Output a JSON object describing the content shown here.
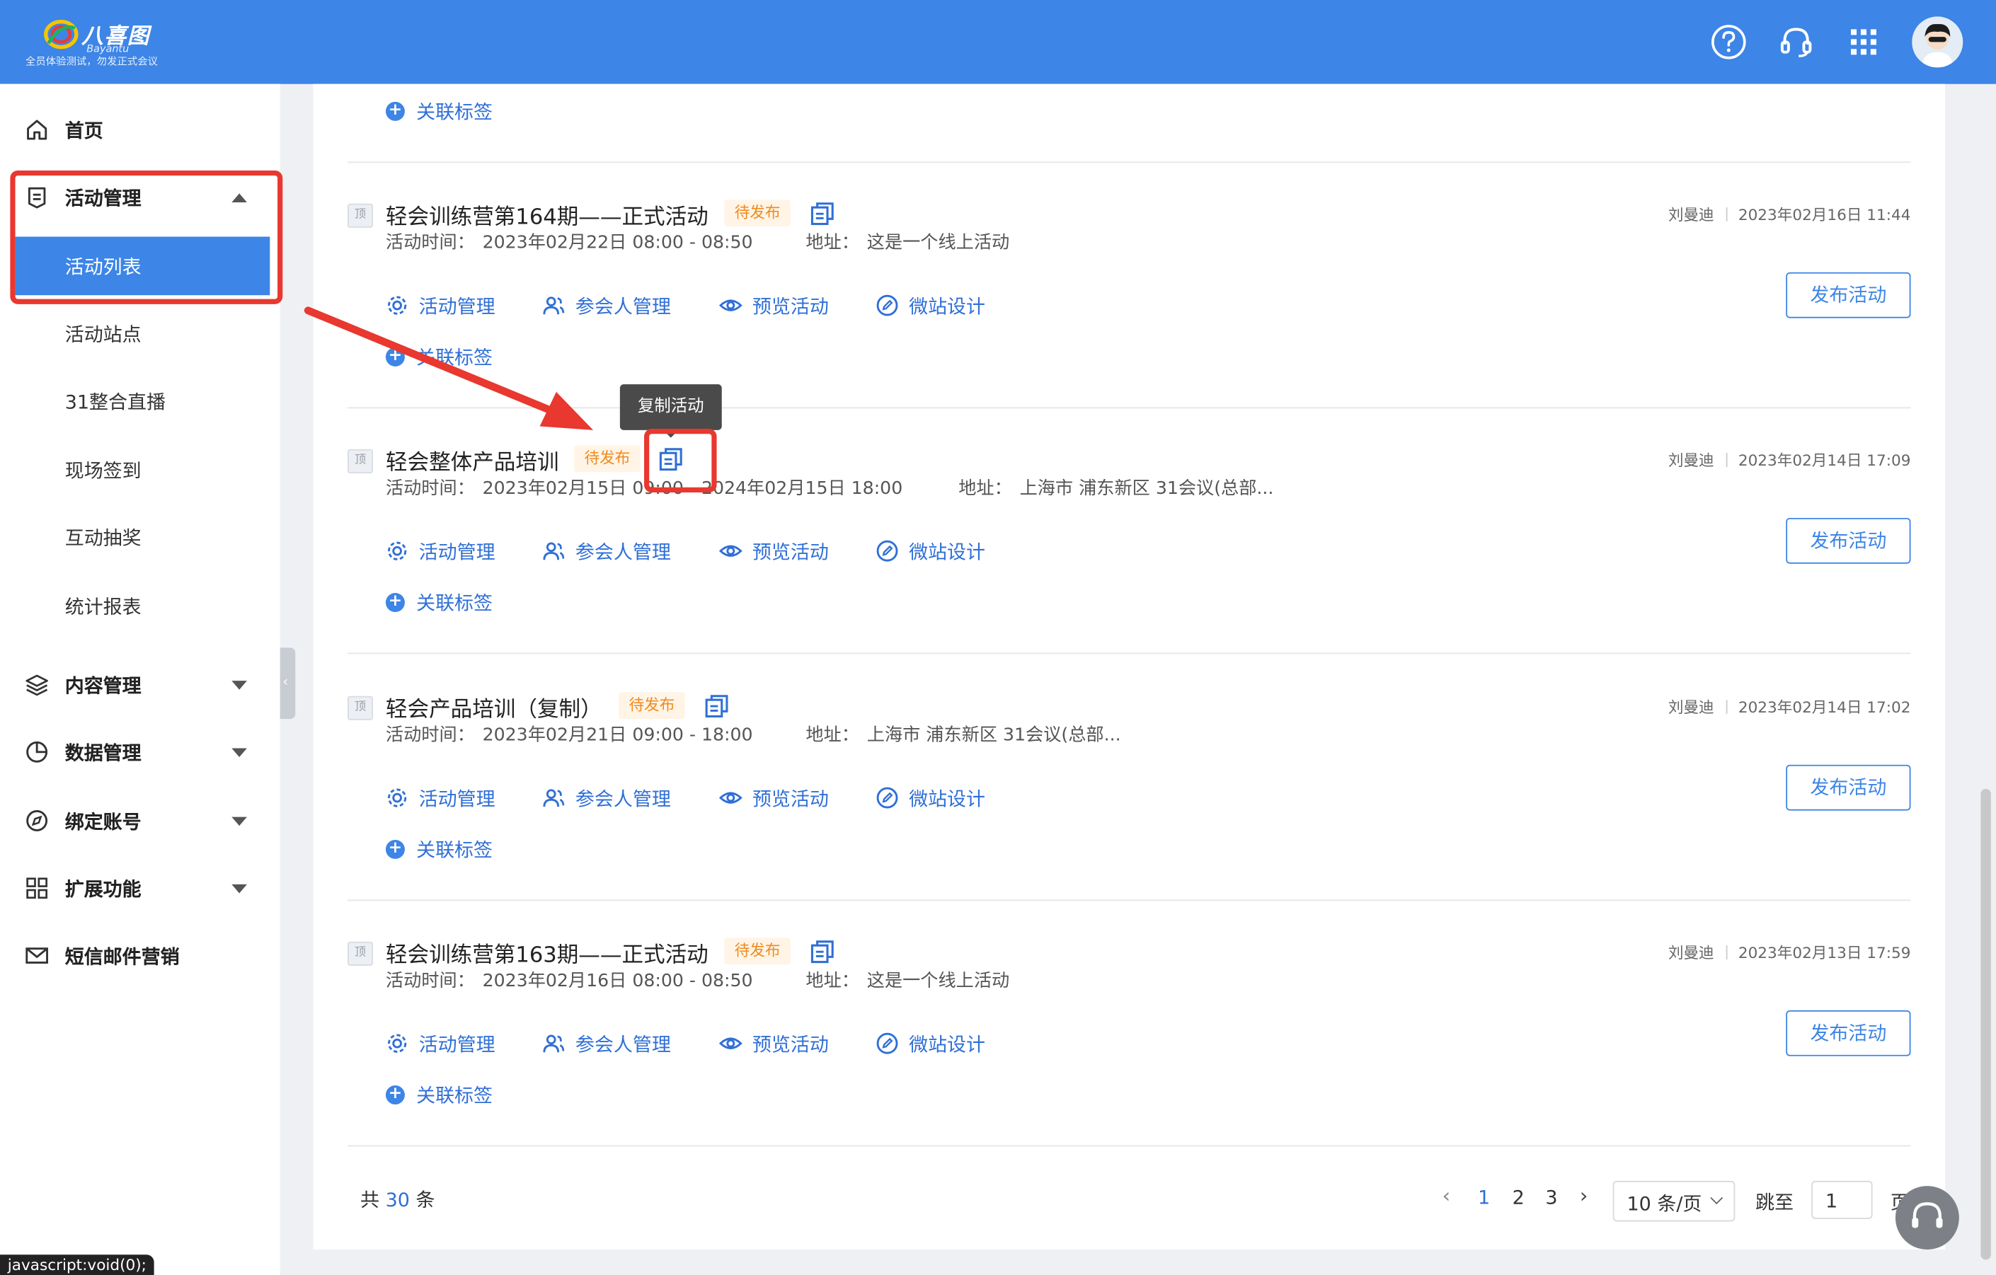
{
  "brand": {
    "name": "八喜图",
    "name_en": "Bayantu",
    "slogan": "全员体验测试，勿发正式会议"
  },
  "header": {
    "icons": [
      "help-circle-icon",
      "headset-icon",
      "apps-grid-icon"
    ],
    "accent": "#3d85e6"
  },
  "sidebar": {
    "home": "首页",
    "activity_mgmt": "活动管理",
    "sub_items": [
      "活动列表",
      "活动站点",
      "31整合直播",
      "现场签到",
      "互动抽奖",
      "统计报表"
    ],
    "content_mgmt": "内容管理",
    "data_mgmt": "数据管理",
    "bind_account": "绑定账号",
    "extensions": "扩展功能",
    "sms_email": "短信邮件营销"
  },
  "ops": {
    "manage": "活动管理",
    "attendees": "参会人管理",
    "preview": "预览活动",
    "microsite": "微站设计",
    "tag": "关联标签",
    "publish": "发布活动"
  },
  "labels": {
    "top_badge": "顶",
    "time_prefix": "活动时间：",
    "addr_prefix": "地址："
  },
  "tooltip": "复制活动",
  "activities": [
    {
      "title": "轻会训练营第164期——正式活动",
      "status": "待发布",
      "time": "2023年02月22日 08:00 - 08:50",
      "address": "这是一个线上活动",
      "author": "刘曼迪",
      "created": "2023年02月16日 11:44"
    },
    {
      "title": "轻会整体产品培训",
      "status": "待发布",
      "time": "2023年02月15日 09:00 - 2024年02月15日 18:00",
      "address": "上海市 浦东新区 31会议(总部...",
      "author": "刘曼迪",
      "created": "2023年02月14日 17:09"
    },
    {
      "title": "轻会产品培训（复制）",
      "status": "待发布",
      "time": "2023年02月21日 09:00 - 18:00",
      "address": "上海市 浦东新区 31会议(总部...",
      "author": "刘曼迪",
      "created": "2023年02月14日 17:02"
    },
    {
      "title": "轻会训练营第163期——正式活动",
      "status": "待发布",
      "time": "2023年02月16日 08:00 - 08:50",
      "address": "这是一个线上活动",
      "author": "刘曼迪",
      "created": "2023年02月13日 17:59"
    }
  ],
  "pagination": {
    "total_prefix": "共",
    "total": "30",
    "total_suffix": "条",
    "pages": [
      "1",
      "2",
      "3"
    ],
    "current": "1",
    "page_size": "10 条/页",
    "jump_label": "跳至",
    "jump_value": "1",
    "page_word": "页"
  },
  "statusbar": "javascript:void(0);"
}
